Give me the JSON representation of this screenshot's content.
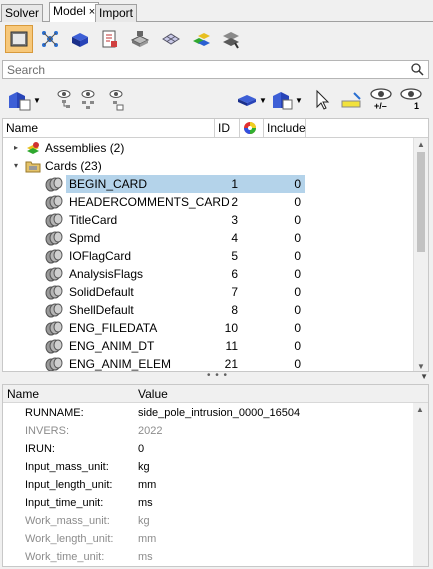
{
  "tabs": [
    {
      "label": "Solver"
    },
    {
      "label": "Model",
      "close": "×"
    },
    {
      "label": "Import"
    }
  ],
  "search": {
    "placeholder": "Search"
  },
  "tree": {
    "columns": {
      "name": "Name",
      "id": "ID",
      "include": "Include"
    },
    "groups": [
      {
        "label": "Assemblies (2)",
        "expander": "▸"
      },
      {
        "label": "Cards (23)",
        "expander": "▾"
      }
    ],
    "rows": [
      {
        "name": "BEGIN_CARD",
        "id": "1",
        "include": "0",
        "selected": true
      },
      {
        "name": "HEADERCOMMENTS_CARD",
        "id": "2",
        "include": "0"
      },
      {
        "name": "TitleCard",
        "id": "3",
        "include": "0"
      },
      {
        "name": "Spmd",
        "id": "4",
        "include": "0"
      },
      {
        "name": "IOFlagCard",
        "id": "5",
        "include": "0"
      },
      {
        "name": "AnalysisFlags",
        "id": "6",
        "include": "0"
      },
      {
        "name": "SolidDefault",
        "id": "7",
        "include": "0"
      },
      {
        "name": "ShellDefault",
        "id": "8",
        "include": "0"
      },
      {
        "name": "ENG_FILEDATA",
        "id": "10",
        "include": "0"
      },
      {
        "name": "ENG_ANIM_DT",
        "id": "11",
        "include": "0"
      },
      {
        "name": "ENG_ANIM_ELEM",
        "id": "21",
        "include": "0"
      }
    ]
  },
  "toolbar2": {
    "visibility_label": "+/–",
    "isolate_label": "1"
  },
  "divider": {
    "dots": "• • •"
  },
  "properties": {
    "columns": {
      "name": "Name",
      "value": "Value"
    },
    "rows": [
      {
        "name": "RUNNAME:",
        "value": "side_pole_intrusion_0000_16504",
        "dim": false
      },
      {
        "name": "INVERS:",
        "value": "2022",
        "dim": true
      },
      {
        "name": "IRUN:",
        "value": "0",
        "dim": false
      },
      {
        "name": "Input_mass_unit:",
        "value": "kg",
        "dim": false
      },
      {
        "name": "Input_length_unit:",
        "value": "mm",
        "dim": false
      },
      {
        "name": "Input_time_unit:",
        "value": "ms",
        "dim": false
      },
      {
        "name": "Work_mass_unit:",
        "value": "kg",
        "dim": true
      },
      {
        "name": "Work_length_unit:",
        "value": "mm",
        "dim": true
      },
      {
        "name": "Work_time_unit:",
        "value": "ms",
        "dim": true
      }
    ]
  },
  "colors": {
    "selection": "#b4d3ea",
    "active_button": "#f7c87a",
    "dim_text": "#8c8c8c"
  }
}
